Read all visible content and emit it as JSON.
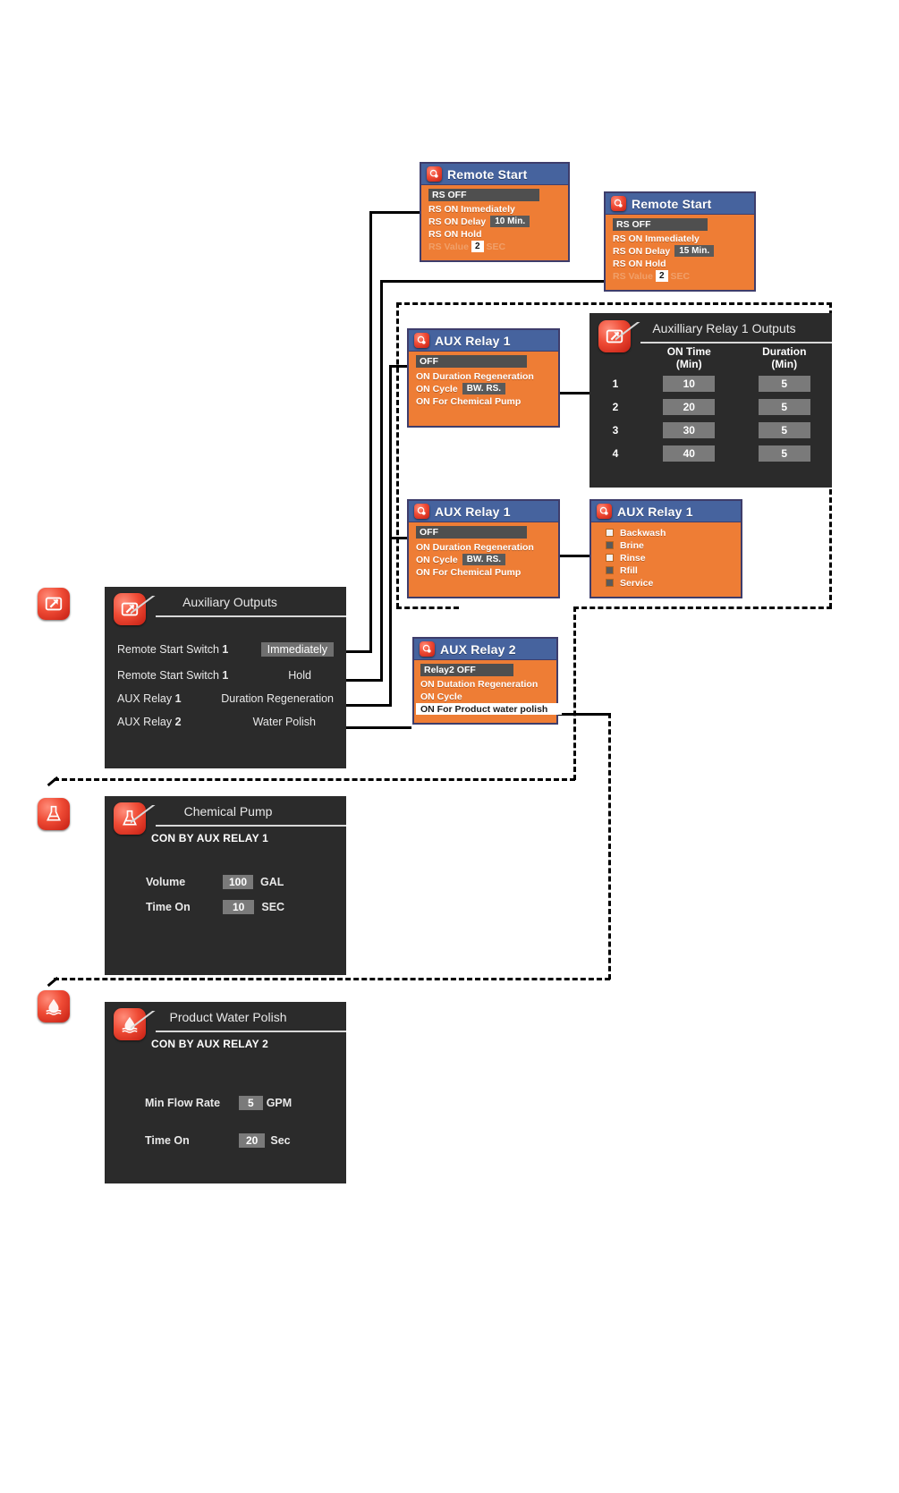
{
  "remote_start_1": {
    "title": "Remote Start",
    "icon": "remote-start-icon",
    "rows": [
      {
        "label": "RS OFF",
        "selected": true
      },
      {
        "label": "RS ON Immediately"
      },
      {
        "label": "RS ON Delay",
        "value": "10 Min."
      },
      {
        "label": "RS ON Hold"
      },
      {
        "label": "RS Value",
        "value": "2",
        "unit": "SEC"
      }
    ]
  },
  "remote_start_2": {
    "title": "Remote Start",
    "icon": "remote-start-icon",
    "rows": [
      {
        "label": "RS OFF",
        "selected": true
      },
      {
        "label": "RS ON Immediately"
      },
      {
        "label": "RS ON Delay",
        "value": "15 Min."
      },
      {
        "label": "RS ON Hold"
      },
      {
        "label": "RS Value",
        "value": "2",
        "unit": "SEC"
      }
    ]
  },
  "aux_relay_1_a": {
    "title": "AUX  Relay 1",
    "icon": "aux-relay-icon",
    "rows": [
      {
        "label": "OFF",
        "selected": true
      },
      {
        "label": "ON  Duration Regeneration"
      },
      {
        "label": "ON  Cycle",
        "value": "BW. RS."
      },
      {
        "label": "ON  For Chemical Pump"
      }
    ]
  },
  "aux_relay_1_b": {
    "title": "AUX  Relay 1",
    "icon": "aux-relay-icon",
    "rows": [
      {
        "label": "OFF",
        "selected": true
      },
      {
        "label": "ON  Duration Regeneration"
      },
      {
        "label": "ON  Cycle",
        "value": "BW. RS."
      },
      {
        "label": "ON  For Chemical Pump"
      }
    ]
  },
  "aux_relay_1_cycles": {
    "title": "AUX  Relay 1",
    "icon": "aux-relay-icon",
    "items": [
      {
        "label": "Backwash",
        "checked": true
      },
      {
        "label": "Brine",
        "checked": false
      },
      {
        "label": "Rinse",
        "checked": true
      },
      {
        "label": "Rfill",
        "checked": false
      },
      {
        "label": "Service",
        "checked": false
      }
    ]
  },
  "aux_relay_2": {
    "title": "AUX  Relay 2",
    "icon": "aux-relay-icon",
    "rows": [
      {
        "label": "Relay2 OFF",
        "selected": true
      },
      {
        "label": "ON  Dutation Regeneration"
      },
      {
        "label": "ON  Cycle"
      },
      {
        "label": "ON  For Product water polish",
        "selected2": true
      }
    ]
  },
  "aux_relay_1_outputs": {
    "title": "Auxilliary Relay 1 Outputs",
    "icon": "auxiliary-outputs-icon",
    "columns": [
      "",
      "ON Time\n(Min)",
      "Duration\n(Min)"
    ],
    "col1_header_line1": "ON Time",
    "col1_header_line2": "(Min)",
    "col2_header_line1": "Duration",
    "col2_header_line2": "(Min)",
    "rows": [
      {
        "index": "1",
        "on_time": "10",
        "duration": "5"
      },
      {
        "index": "2",
        "on_time": "20",
        "duration": "5"
      },
      {
        "index": "3",
        "on_time": "30",
        "duration": "5"
      },
      {
        "index": "4",
        "on_time": "40",
        "duration": "5"
      }
    ]
  },
  "auxiliary_outputs": {
    "title": "Auxiliary Outputs",
    "icon": "auxiliary-outputs-icon",
    "rows": [
      {
        "key": "Remote Start Switch",
        "num": "1",
        "value": "Immediately",
        "highlight": true
      },
      {
        "key": "Remote Start Switch",
        "num": "1",
        "value": "Hold",
        "highlight": false
      },
      {
        "key": "AUX Relay",
        "num": "1",
        "value": "Duration Regeneration",
        "highlight": false
      },
      {
        "key": "AUX Relay",
        "num": "2",
        "value": "Water Polish",
        "highlight": false
      }
    ]
  },
  "chemical_pump": {
    "title": "Chemical Pump",
    "icon": "flask-icon",
    "subtitle": "CON BY AUX RELAY 1",
    "fields": [
      {
        "label": "Volume",
        "value": "100",
        "unit": "GAL"
      },
      {
        "label": "Time On",
        "value": "10",
        "unit": "SEC"
      }
    ]
  },
  "product_water_polish": {
    "title": "Product Water Polish",
    "icon": "water-polish-icon",
    "subtitle": "CON BY AUX RELAY 2",
    "fields": [
      {
        "label": "Min Flow Rate",
        "value": "5",
        "unit": "GPM"
      },
      {
        "label": "Time On",
        "value": "20",
        "unit": "Sec"
      }
    ]
  },
  "colors": {
    "panel_orange": "#ee7d35",
    "header_blue": "#46639e",
    "dark_panel": "#2b2b2b",
    "icon_red": "#ef4b35",
    "field_gray": "#7a7a7a"
  }
}
